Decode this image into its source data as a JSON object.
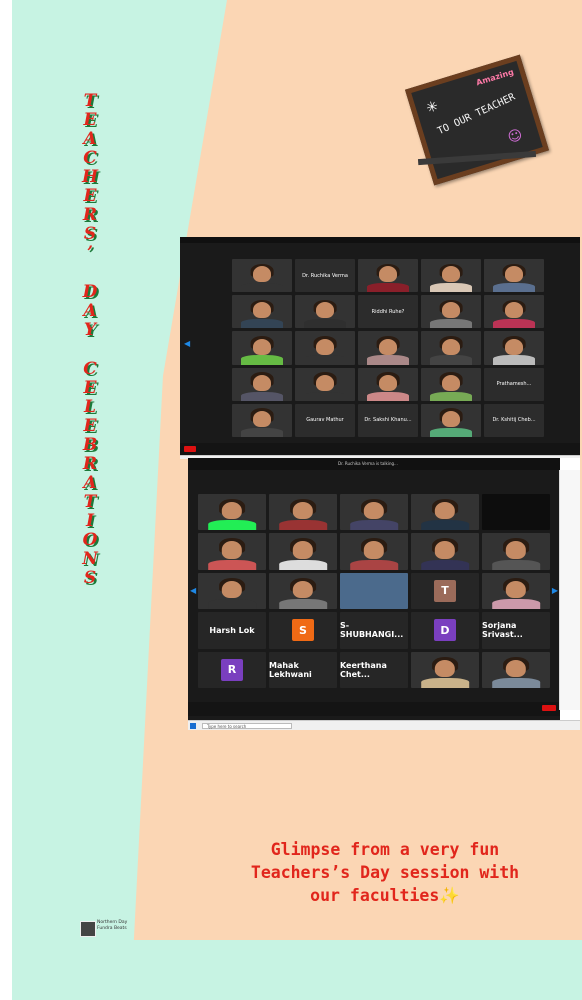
{
  "title": {
    "letters_line1": [
      "T",
      "E",
      "A",
      "C",
      "H",
      "E",
      "R",
      "S",
      "’"
    ],
    "letters_line2": [
      "D",
      "A",
      "Y"
    ],
    "letters_line3": [
      "C",
      "E",
      "L",
      "E",
      "B",
      "R",
      "A",
      "T",
      "I",
      "O",
      "N",
      "S"
    ]
  },
  "chalkboard": {
    "text": "TO OUR TEACHER",
    "tag": "Amazing"
  },
  "screenshot1": {
    "tiles": [
      {
        "kind": "person",
        "shirt": "#333"
      },
      {
        "kind": "name",
        "text": "Dr. Ruchika Verma"
      },
      {
        "kind": "person",
        "shirt": "#8a1f2a"
      },
      {
        "kind": "person",
        "shirt": "#d9c7b5"
      },
      {
        "kind": "person",
        "shirt": "#5a6f8f"
      },
      {
        "kind": "person",
        "shirt": "#345"
      },
      {
        "kind": "person",
        "shirt": "#2f2f2f"
      },
      {
        "kind": "name",
        "text": "Riddhi Ruhe?"
      },
      {
        "kind": "person",
        "shirt": "#777"
      },
      {
        "kind": "person",
        "shirt": "#b35"
      },
      {
        "kind": "person",
        "shirt": "#6b4"
      },
      {
        "kind": "person",
        "shirt": "#333"
      },
      {
        "kind": "person",
        "shirt": "#a88"
      },
      {
        "kind": "person",
        "shirt": "#444"
      },
      {
        "kind": "person",
        "shirt": "#bbb"
      },
      {
        "kind": "person",
        "shirt": "#556"
      },
      {
        "kind": "person",
        "shirt": "#333"
      },
      {
        "kind": "person",
        "shirt": "#c88"
      },
      {
        "kind": "person",
        "shirt": "#7a5"
      },
      {
        "kind": "name",
        "text": "Prathamesh..."
      },
      {
        "kind": "person",
        "shirt": "#444"
      },
      {
        "kind": "name",
        "text": "Gaurav Mathur"
      },
      {
        "kind": "name",
        "text": "Dr. Sakshi Khanu..."
      },
      {
        "kind": "person",
        "shirt": "#5a7"
      },
      {
        "kind": "name",
        "text": "Dr. Kshitij Cheb..."
      }
    ]
  },
  "screenshot2": {
    "meeting_title": "Dr. Ruchika Verma is talking...",
    "row_names": [
      {
        "text": "Harsh Lok",
        "initial": ""
      },
      {
        "text": "",
        "initial": "S",
        "color": "#f06a15"
      },
      {
        "text": "S-SHUBHANGI...",
        "initial": ""
      },
      {
        "text": "",
        "initial": "D",
        "color": "#7a3fbf"
      },
      {
        "text": "Sorjana Srivast...",
        "initial": ""
      }
    ],
    "row_last": [
      {
        "text": "",
        "initial": "R",
        "color": "#7a3fbf"
      },
      {
        "text": "Mahak Lekhwani",
        "initial": ""
      },
      {
        "text": "Keerthana Chet...",
        "initial": ""
      }
    ],
    "tile_T": "T",
    "search_placeholder": "Type here to search"
  },
  "caption": {
    "line1": "Glimpse from a very fun",
    "line2": "Teachers’s Day session with",
    "line3": "our faculties",
    "sparkle": "✨"
  },
  "credit": {
    "line1": "Northern Day",
    "line2": "Fundra Beats"
  },
  "colors": {
    "mint": "#c7f3e3",
    "peach": "#fbd6b4",
    "title_red": "#e1261c",
    "title_shadow": "#1c7a3a"
  }
}
